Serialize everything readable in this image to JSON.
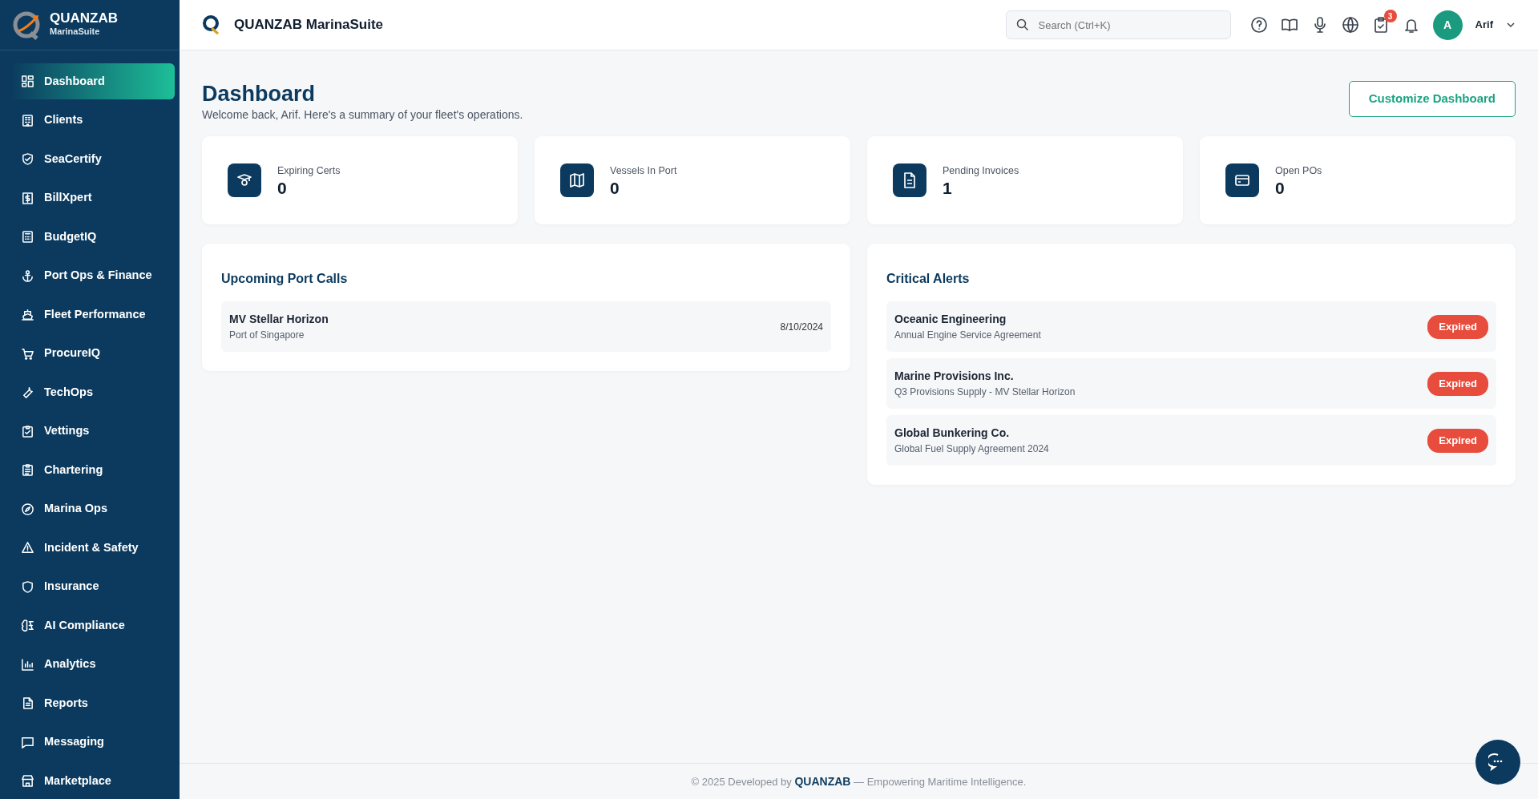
{
  "brand": {
    "name": "QUANZAB",
    "subtitle": "MarinaSuite"
  },
  "sidebar": {
    "items": [
      {
        "label": "Dashboard",
        "selected": true
      },
      {
        "label": "Clients",
        "selected": false
      },
      {
        "label": "SeaCertify",
        "selected": false
      },
      {
        "label": "BillXpert",
        "selected": false
      },
      {
        "label": "BudgetIQ",
        "selected": false
      },
      {
        "label": "Port Ops & Finance",
        "selected": false
      },
      {
        "label": "Fleet Performance",
        "selected": false
      },
      {
        "label": "ProcureIQ",
        "selected": false
      },
      {
        "label": "TechOps",
        "selected": false
      },
      {
        "label": "Vettings",
        "selected": false
      },
      {
        "label": "Chartering",
        "selected": false
      },
      {
        "label": "Marina Ops",
        "selected": false
      },
      {
        "label": "Incident & Safety",
        "selected": false
      },
      {
        "label": "Insurance",
        "selected": false
      },
      {
        "label": "AI Compliance",
        "selected": false
      },
      {
        "label": "Analytics",
        "selected": false
      },
      {
        "label": "Reports",
        "selected": false
      },
      {
        "label": "Messaging",
        "selected": false
      },
      {
        "label": "Marketplace",
        "selected": false
      }
    ]
  },
  "header": {
    "title": "QUANZAB MarinaSuite",
    "search": {
      "placeholder": "Search (Ctrl+K)"
    },
    "tasks_badge": "3",
    "avatar_initial": "A",
    "user_name": "Arif"
  },
  "page": {
    "title": "Dashboard",
    "subtitle": "Welcome back, Arif. Here's a summary of your fleet's operations.",
    "action": "Customize Dashboard"
  },
  "stats": [
    {
      "label": "Expiring Certs",
      "value": "0"
    },
    {
      "label": "Vessels In Port",
      "value": "0"
    },
    {
      "label": "Pending Invoices",
      "value": "1"
    },
    {
      "label": "Open POs",
      "value": "0"
    }
  ],
  "port_calls": {
    "title": "Upcoming Port Calls",
    "items": [
      {
        "vessel": "MV Stellar Horizon",
        "port": "Port of Singapore",
        "date": "8/10/2024"
      }
    ]
  },
  "alerts": {
    "title": "Critical Alerts",
    "items": [
      {
        "name": "Oceanic Engineering",
        "detail": "Annual Engine Service Agreement",
        "status": "Expired",
        "color": "#e74c3c"
      },
      {
        "name": "Marine Provisions Inc.",
        "detail": "Q3 Provisions Supply - MV Stellar Horizon",
        "status": "Expired",
        "color": "#e74c3c"
      },
      {
        "name": "Global Bunkering Co.",
        "detail": "Global Fuel Supply Agreement 2024",
        "status": "Expired",
        "color": "#e74c3c"
      }
    ]
  },
  "footer": "© 2025 Developed by **QUANZAB** — Empowering Maritime Intelligence."
}
